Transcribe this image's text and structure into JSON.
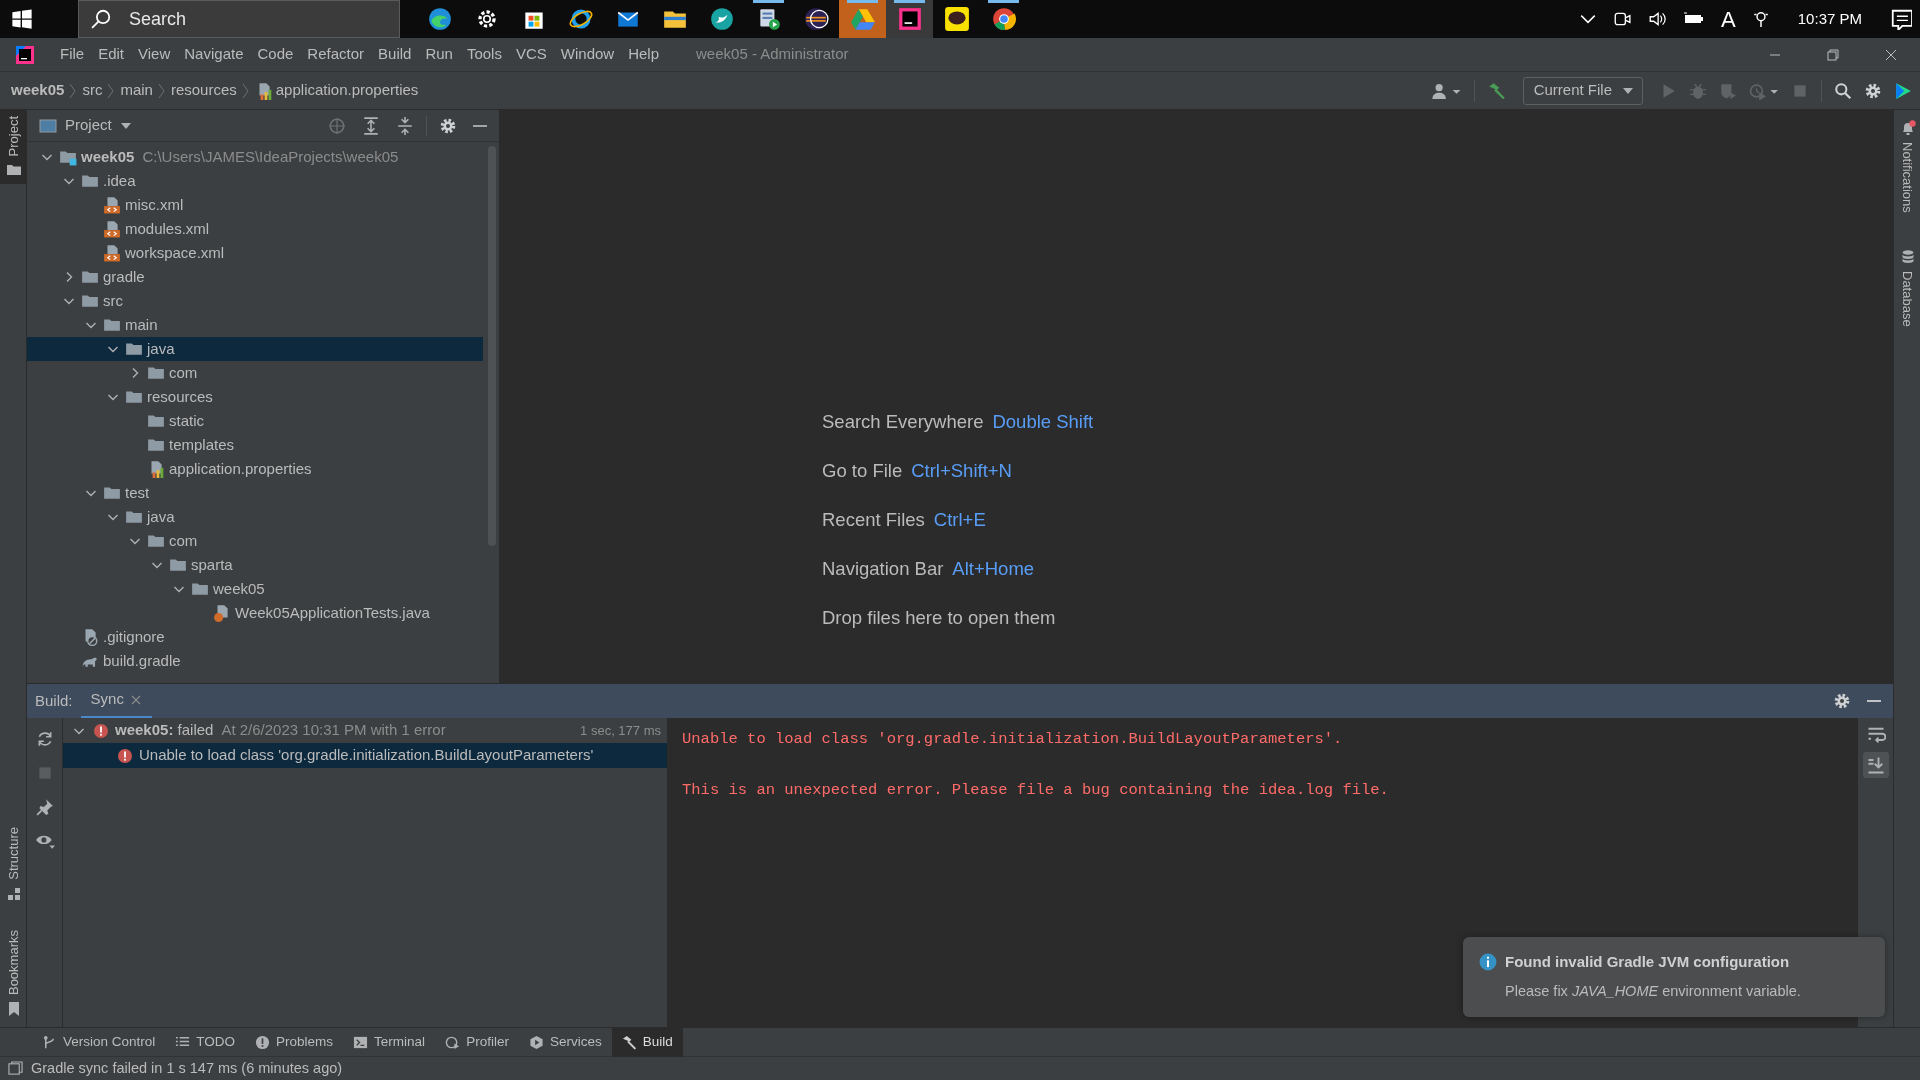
{
  "taskbar": {
    "search": {
      "placeholder": "Search"
    },
    "apps": [
      {
        "kind": "edge",
        "running": false,
        "selected": false
      },
      {
        "kind": "settings",
        "running": false,
        "selected": false
      },
      {
        "kind": "store",
        "running": false,
        "selected": false
      },
      {
        "kind": "ie",
        "running": false,
        "selected": false
      },
      {
        "kind": "mail",
        "running": false,
        "selected": false
      },
      {
        "kind": "explorer",
        "running": false,
        "selected": false
      },
      {
        "kind": "bird",
        "running": false,
        "selected": false
      },
      {
        "kind": "media",
        "running": true,
        "selected": false
      },
      {
        "kind": "eclipse",
        "running": false,
        "selected": false
      },
      {
        "kind": "drive",
        "running": true,
        "selected": false
      },
      {
        "kind": "intellij",
        "running": true,
        "selected": true
      },
      {
        "kind": "chat",
        "running": false,
        "selected": false
      },
      {
        "kind": "chrome",
        "running": true,
        "selected": false
      }
    ],
    "ime": "A",
    "clock": "10:37 PM"
  },
  "menu_bar": {
    "items": [
      "File",
      "Edit",
      "View",
      "Navigate",
      "Code",
      "Refactor",
      "Build",
      "Run",
      "Tools",
      "VCS",
      "Window",
      "Help"
    ],
    "title": "week05 - Administrator"
  },
  "breadcrumbs": [
    {
      "label": "week05",
      "kind": "project"
    },
    {
      "label": "src",
      "kind": "folder"
    },
    {
      "label": "main",
      "kind": "folder"
    },
    {
      "label": "resources",
      "kind": "folder"
    },
    {
      "label": "application.properties",
      "kind": "properties"
    }
  ],
  "toolbar": {
    "run_configuration": "Current File"
  },
  "left_stripe": [
    {
      "label": "Project",
      "kind": "project",
      "selected": true
    },
    {
      "label": "Structure",
      "kind": "structure",
      "selected": false
    },
    {
      "label": "Bookmarks",
      "kind": "bookmarks",
      "selected": false
    }
  ],
  "project_panel": {
    "title": "Project",
    "tree": [
      {
        "label": "week05",
        "kind": "module",
        "path": "C:\\Users\\JAMES\\IdeaProjects\\week05",
        "expanded": true,
        "selected": false,
        "children": [
          {
            "label": ".idea",
            "kind": "folder",
            "expanded": true,
            "selected": false,
            "children": [
              {
                "label": "misc.xml",
                "kind": "xml",
                "selected": false
              },
              {
                "label": "modules.xml",
                "kind": "xml",
                "selected": false
              },
              {
                "label": "workspace.xml",
                "kind": "xml",
                "selected": false
              }
            ]
          },
          {
            "label": "gradle",
            "kind": "folder",
            "expanded": false,
            "selected": false
          },
          {
            "label": "src",
            "kind": "folder",
            "expanded": true,
            "selected": false,
            "children": [
              {
                "label": "main",
                "kind": "folder",
                "expanded": true,
                "selected": false,
                "children": [
                  {
                    "label": "java",
                    "kind": "folder",
                    "expanded": true,
                    "selected": true,
                    "children": [
                      {
                        "label": "com",
                        "kind": "folder",
                        "expanded": false,
                        "selected": false
                      }
                    ]
                  },
                  {
                    "label": "resources",
                    "kind": "folder",
                    "expanded": true,
                    "selected": false,
                    "children": [
                      {
                        "label": "static",
                        "kind": "folder",
                        "selected": false
                      },
                      {
                        "label": "templates",
                        "kind": "folder",
                        "selected": false
                      },
                      {
                        "label": "application.properties",
                        "kind": "properties",
                        "selected": false
                      }
                    ]
                  }
                ]
              },
              {
                "label": "test",
                "kind": "folder",
                "expanded": true,
                "selected": false,
                "children": [
                  {
                    "label": "java",
                    "kind": "folder",
                    "expanded": true,
                    "selected": false,
                    "children": [
                      {
                        "label": "com",
                        "kind": "folder",
                        "expanded": true,
                        "selected": false,
                        "children": [
                          {
                            "label": "sparta",
                            "kind": "folder",
                            "expanded": true,
                            "selected": false,
                            "children": [
                              {
                                "label": "week05",
                                "kind": "folder",
                                "expanded": true,
                                "selected": false,
                                "children": [
                                  {
                                    "label": "Week05ApplicationTests.java",
                                    "kind": "java",
                                    "selected": false
                                  }
                                ]
                              }
                            ]
                          }
                        ]
                      }
                    ]
                  }
                ]
              }
            ]
          },
          {
            "label": ".gitignore",
            "kind": "gitignore",
            "selected": false
          },
          {
            "label": "build.gradle",
            "kind": "gradle",
            "selected": false
          }
        ]
      }
    ]
  },
  "editor": {
    "hints": [
      {
        "label": "Search Everywhere",
        "shortcut": "Double Shift"
      },
      {
        "label": "Go to File",
        "shortcut": "Ctrl+Shift+N"
      },
      {
        "label": "Recent Files",
        "shortcut": "Ctrl+E"
      },
      {
        "label": "Navigation Bar",
        "shortcut": "Alt+Home"
      },
      {
        "label": "Drop files here to open them"
      }
    ]
  },
  "right_stripe": [
    {
      "label": "Notifications",
      "kind": "notifications",
      "unread": true
    },
    {
      "label": "Database",
      "kind": "database",
      "unread": false
    }
  ],
  "build_panel": {
    "title": "Build:",
    "tabs": [
      {
        "label": "Sync",
        "selected": true
      }
    ],
    "tree": [
      {
        "label": "**week05:** failed",
        "detail": "At 2/6/2023 10:31 PM with 1 error",
        "duration": "1 sec, 177 ms",
        "kind": "error",
        "expanded": true,
        "selected": false,
        "children": [
          {
            "label": "Unable to load class 'org.gradle.initialization.BuildLayoutParameters'",
            "kind": "error",
            "selected": true
          }
        ]
      }
    ],
    "console": [
      "Unable to load class 'org.gradle.initialization.BuildLayoutParameters'.",
      "This is an unexpected error. Please file a bug containing the idea.log file."
    ]
  },
  "notification": {
    "kind": "info",
    "title": "Found invalid Gradle JVM configuration",
    "body": "Please fix *JAVA_HOME* environment variable."
  },
  "tool_tabs": [
    {
      "label": "Version Control",
      "kind": "vcs",
      "selected": false
    },
    {
      "label": "TODO",
      "kind": "todo",
      "selected": false
    },
    {
      "label": "Problems",
      "kind": "problems",
      "selected": false
    },
    {
      "label": "Terminal",
      "kind": "terminal",
      "selected": false
    },
    {
      "label": "Profiler",
      "kind": "profiler",
      "selected": false
    },
    {
      "label": "Services",
      "kind": "services",
      "selected": false
    },
    {
      "label": "Build",
      "kind": "build",
      "selected": true
    }
  ],
  "status_bar": {
    "text": "Gradle sync failed in 1 s 147 ms (6 minutes ago)"
  }
}
